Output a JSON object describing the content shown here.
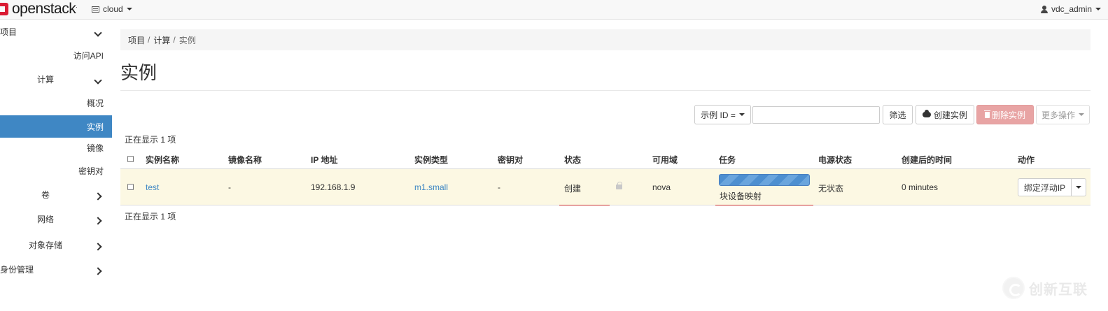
{
  "navbar": {
    "brand": "openstack",
    "brand_mark": ".",
    "project": "cloud",
    "user": "vdc_admin"
  },
  "sidebar": {
    "items": [
      {
        "label": "项目",
        "level": 0,
        "chevron": "down"
      },
      {
        "label": "访问API",
        "level": 2
      },
      {
        "label": "计算",
        "level": 1,
        "chevron": "down"
      },
      {
        "label": "概况",
        "level": 2
      },
      {
        "label": "实例",
        "level": 2,
        "active": true
      },
      {
        "label": "镜像",
        "level": 2
      },
      {
        "label": "密钥对",
        "level": 2
      },
      {
        "label": "卷",
        "level": 1,
        "chevron": "right"
      },
      {
        "label": "网络",
        "level": 1,
        "chevron": "right"
      },
      {
        "label": "对象存储",
        "level": 1,
        "chevron": "right"
      },
      {
        "label": "身份管理",
        "level": 0,
        "chevron": "right"
      }
    ]
  },
  "breadcrumb": {
    "items": [
      "项目",
      "计算",
      "实例"
    ],
    "separator": "/"
  },
  "page": {
    "title": "实例"
  },
  "toolbar": {
    "filter_select": "示例 ID =",
    "filter_value": "",
    "filter_button": "筛选",
    "create_button": "创建实例",
    "delete_button": "删除实例",
    "more_button": "更多操作"
  },
  "table": {
    "count_top": "正在显示 1 项",
    "count_bottom": "正在显示 1 项",
    "headers": [
      "实例名称",
      "镜像名称",
      "IP 地址",
      "实例类型",
      "密钥对",
      "状态",
      "可用域",
      "任务",
      "电源状态",
      "创建后的时间",
      "动作"
    ],
    "rows": [
      {
        "name": "test",
        "image": "-",
        "ip": "192.168.1.9",
        "flavor": "m1.small",
        "keypair": "-",
        "status": "创建",
        "zone": "nova",
        "task": "块设备映射",
        "task_progress": 1.0,
        "power": "无状态",
        "age": "0 minutes",
        "action": "绑定浮动IP"
      }
    ]
  },
  "watermark": {
    "text": "创新互联"
  },
  "colors": {
    "active_sidebar": "#3f87c4",
    "link": "#3f87c4",
    "danger": "#e8a4a4",
    "row_highlight": "#fcf8e3"
  }
}
